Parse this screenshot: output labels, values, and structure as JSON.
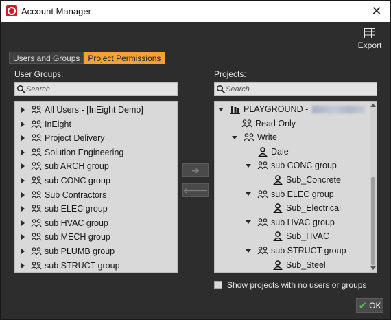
{
  "window": {
    "title": "Account Manager"
  },
  "toolbar": {
    "export_label": "Export"
  },
  "tabs": [
    {
      "label": "Users and Groups",
      "active": false
    },
    {
      "label": "Project Permissions",
      "active": true
    }
  ],
  "left_panel": {
    "label": "User Groups:",
    "search_placeholder": "Search",
    "items": [
      {
        "label": "All Users - [InEight Demo]",
        "icon": "group-icon"
      },
      {
        "label": "InEight",
        "icon": "group-icon"
      },
      {
        "label": "Project Delivery",
        "icon": "group-icon"
      },
      {
        "label": "Solution Engineering",
        "icon": "group-icon"
      },
      {
        "label": "sub ARCH group",
        "icon": "group-icon"
      },
      {
        "label": "sub CONC group",
        "icon": "group-icon"
      },
      {
        "label": "Sub Contractors",
        "icon": "group-icon"
      },
      {
        "label": "sub ELEC group",
        "icon": "group-icon"
      },
      {
        "label": "sub HVAC group",
        "icon": "group-icon"
      },
      {
        "label": "sub MECH group",
        "icon": "group-icon"
      },
      {
        "label": "sub PLUMB group",
        "icon": "group-icon"
      },
      {
        "label": "sub STRUCT group",
        "icon": "group-icon"
      }
    ]
  },
  "right_panel": {
    "label": "Projects:",
    "search_placeholder": "Search",
    "tree": [
      {
        "label": "PLAYGROUND -",
        "icon": "building-icon",
        "level": 0,
        "expand": "down",
        "redacted": true
      },
      {
        "label": "Read Only",
        "icon": "group-icon",
        "level": 1,
        "expand": "none"
      },
      {
        "label": "Write",
        "icon": "group-icon",
        "level": 1,
        "expand": "down"
      },
      {
        "label": "Dale",
        "icon": "user-icon",
        "level": 2,
        "expand": "none"
      },
      {
        "label": "sub CONC group",
        "icon": "group-icon",
        "level": 2,
        "expand": "down"
      },
      {
        "label": "Sub_Concrete",
        "icon": "user-icon",
        "level": 3,
        "expand": "none"
      },
      {
        "label": "sub ELEC group",
        "icon": "group-icon",
        "level": 2,
        "expand": "down"
      },
      {
        "label": "Sub_Electrical",
        "icon": "user-icon",
        "level": 3,
        "expand": "none"
      },
      {
        "label": "sub HVAC group",
        "icon": "group-icon",
        "level": 2,
        "expand": "down"
      },
      {
        "label": "Sub_HVAC",
        "icon": "user-icon",
        "level": 3,
        "expand": "none"
      },
      {
        "label": "sub STRUCT group",
        "icon": "group-icon",
        "level": 2,
        "expand": "down"
      },
      {
        "label": "Sub_Steel",
        "icon": "user-icon",
        "level": 3,
        "expand": "none"
      }
    ]
  },
  "transfer": {
    "add_symbol": "➔",
    "remove_symbol": "🡐"
  },
  "footer": {
    "show_empty_label": "Show projects with no users or groups",
    "ok_label": "OK"
  },
  "colors": {
    "accent": "#f3a23a",
    "background": "#2d2d2d",
    "list_bg": "#d9d9d9",
    "ok_check": "#58c14a"
  }
}
